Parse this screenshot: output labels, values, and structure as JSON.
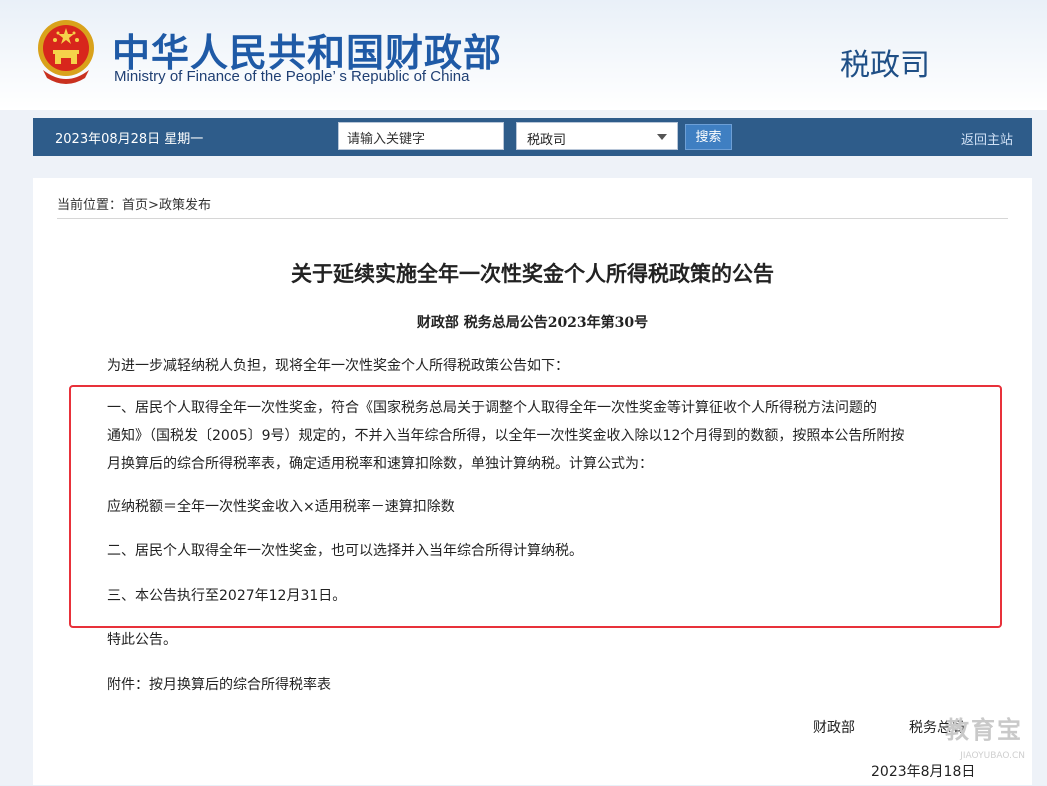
{
  "header": {
    "title_cn": "中华人民共和国财政部",
    "title_en": "Ministry of Finance of the People’ s Republic of China",
    "department": "税政司"
  },
  "navbar": {
    "date": "2023年08月28日  星期一",
    "search_placeholder": "请输入关键字",
    "select_value": "税政司",
    "search_button": "搜索",
    "home_link": "返回主站"
  },
  "breadcrumb": {
    "label": "当前位置：",
    "home": "首页",
    "separator": ">",
    "current": "政策发布"
  },
  "article": {
    "title": "关于延续实施全年一次性奖金个人所得税政策的公告",
    "subtitle": "财政部  税务总局公告2023年第30号",
    "intro": "为进一步减轻纳税人负担，现将全年一次性奖金个人所得税政策公告如下：",
    "para1_line1": "一、居民个人取得全年一次性奖金，符合《国家税务总局关于调整个人取得全年一次性奖金等计算征收个人所得税方法问题的",
    "para1_line2": "通知》（国税发〔2005〕9号）规定的，不并入当年综合所得，以全年一次性奖金收入除以12个月得到的数额，按照本公告所附按",
    "para1_line3": "月换算后的综合所得税率表，确定适用税率和速算扣除数，单独计算纳税。计算公式为：",
    "formula": "应纳税额＝全年一次性奖金收入×适用税率－速算扣除数",
    "para2": "二、居民个人取得全年一次性奖金，也可以选择并入当年综合所得计算纳税。",
    "para3": "三、本公告执行至2027年12月31日。",
    "closing": "特此公告。",
    "attachment": "附件：按月换算后的综合所得税率表",
    "signature_1": "财政部",
    "signature_2": "税务总局",
    "date": "2023年8月18日"
  },
  "watermark": {
    "cn": "教育宝",
    "en": "JIAOYUBAO.CN"
  },
  "colors": {
    "brand_blue": "#1f5aa6",
    "nav_bar": "#2e5c8a",
    "highlight_red": "#e8313a"
  }
}
